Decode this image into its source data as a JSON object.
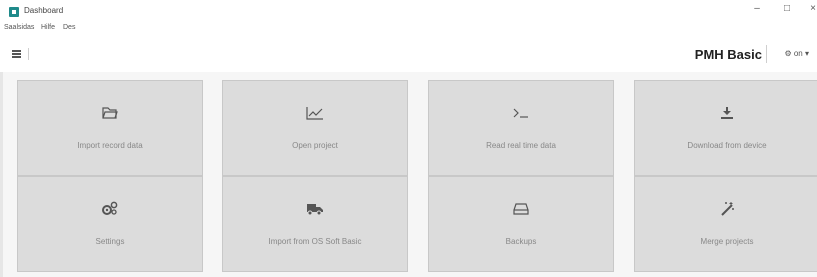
{
  "window": {
    "title": "Dashboard",
    "controls": {
      "minimize": "–",
      "maximize": "□",
      "close": "×"
    }
  },
  "menu": [
    "Saalsidas",
    "Hilfe",
    "Des"
  ],
  "toolbar": {
    "product_name": "PMH Basic",
    "user_label": "on"
  },
  "tiles": [
    {
      "label": "Import record data",
      "icon": "folder-open-icon"
    },
    {
      "label": "Open project",
      "icon": "line-chart-icon"
    },
    {
      "label": "Read real time data",
      "icon": "terminal-icon"
    },
    {
      "label": "Download from device",
      "icon": "download-icon"
    },
    {
      "label": "Settings",
      "icon": "gears-icon"
    },
    {
      "label": "Import from OS Soft Basic",
      "icon": "truck-icon"
    },
    {
      "label": "Backups",
      "icon": "hdd-icon"
    },
    {
      "label": "Merge projects",
      "icon": "magic-wand-icon"
    }
  ]
}
